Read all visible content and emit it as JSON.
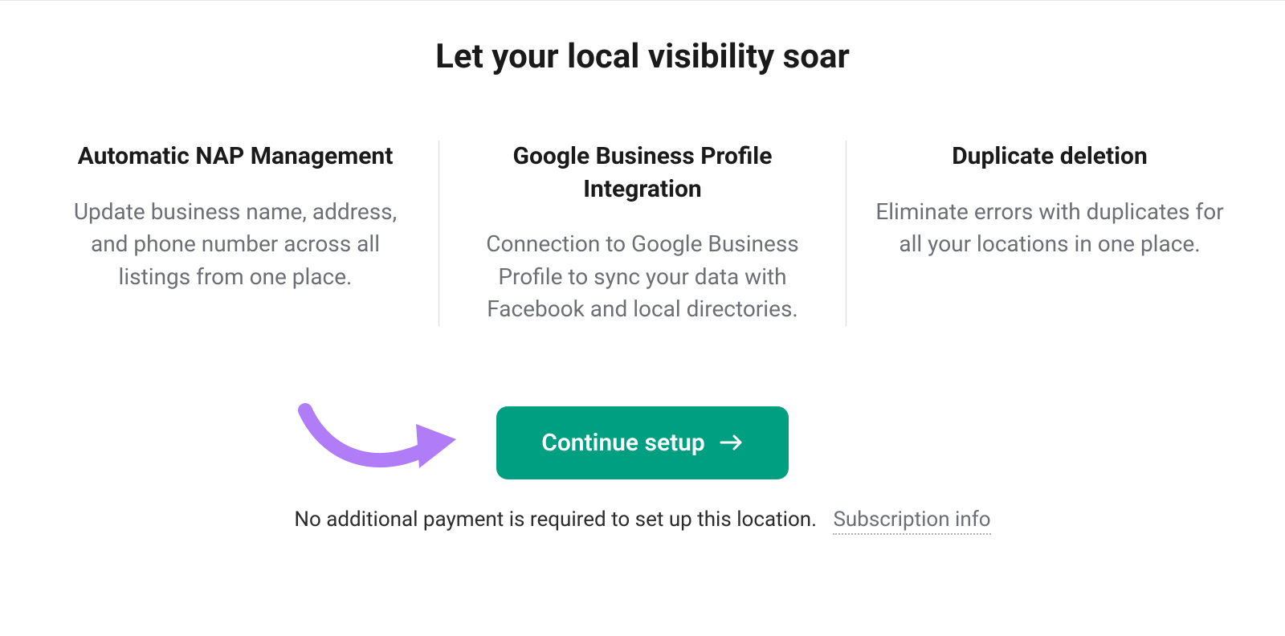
{
  "title": "Let your local visibility soar",
  "features": [
    {
      "title": "Automatic NAP Management",
      "desc": "Update business name, address, and phone number across all listings from one place."
    },
    {
      "title": "Google Business Profile Integration",
      "desc": "Connection to Google Business Profile to sync your data with Facebook and local directories."
    },
    {
      "title": "Duplicate deletion",
      "desc": "Eliminate errors with duplicates for all your locations in one place."
    }
  ],
  "cta": {
    "label": "Continue setup"
  },
  "footer": {
    "note": "No additional payment is required to set up this location.",
    "link": "Subscription info"
  },
  "colors": {
    "accent": "#009f81",
    "annotation": "#b07cf7"
  }
}
